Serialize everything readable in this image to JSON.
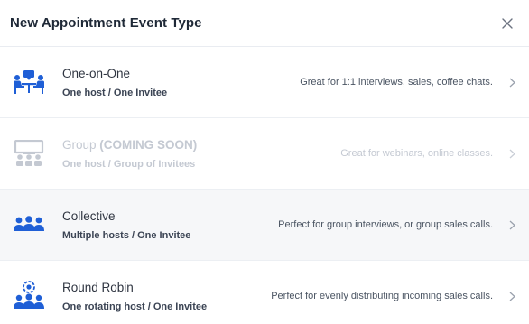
{
  "dialog": {
    "title": "New Appointment Event Type"
  },
  "colors": {
    "icon_blue": "#1f5fd6",
    "disabled": "#c4c9d2"
  },
  "types": [
    {
      "name": "One-on-One",
      "name_suffix": "",
      "subtitle": "One host / One Invitee",
      "description": "Great for 1:1 interviews, sales, coffee chats.",
      "icon": "one-on-one-icon",
      "disabled": false
    },
    {
      "name": "Group ",
      "name_suffix": "(COMING SOON)",
      "subtitle": "One host / Group of Invitees",
      "description": "Great for webinars, online classes.",
      "icon": "group-presentation-icon",
      "disabled": true
    },
    {
      "name": "Collective",
      "name_suffix": "",
      "subtitle": "Multiple hosts / One Invitee",
      "description": "Perfect for group interviews, or group sales calls.",
      "icon": "collective-icon",
      "disabled": false
    },
    {
      "name": "Round Robin",
      "name_suffix": "",
      "subtitle": "One rotating host / One Invitee",
      "description": "Perfect for evenly distributing incoming sales calls.",
      "icon": "round-robin-icon",
      "disabled": false
    }
  ]
}
